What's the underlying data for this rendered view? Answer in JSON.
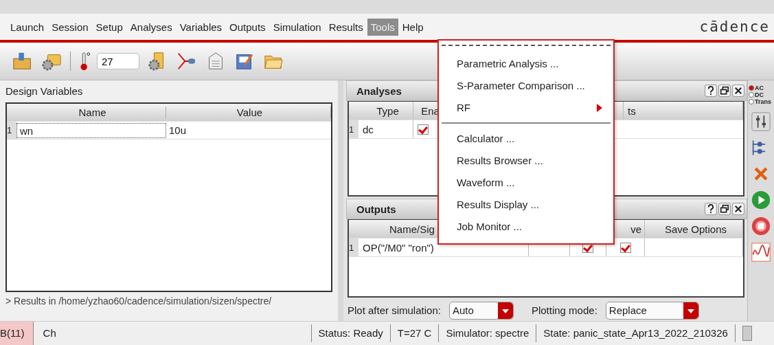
{
  "menu_bar": {
    "items": [
      {
        "label": "Launch",
        "selected": false
      },
      {
        "label": "Session",
        "selected": false
      },
      {
        "label": "Setup",
        "selected": false
      },
      {
        "label": "Analyses",
        "selected": false
      },
      {
        "label": "Variables",
        "selected": false
      },
      {
        "label": "Outputs",
        "selected": false
      },
      {
        "label": "Simulation",
        "selected": false
      },
      {
        "label": "Results",
        "selected": false
      },
      {
        "label": "Tools",
        "selected": true
      },
      {
        "label": "Help",
        "selected": false
      }
    ],
    "logo": "cādence"
  },
  "toolbar": {
    "temperature": "27"
  },
  "design_variables": {
    "title": "Design Variables",
    "columns": [
      "Name",
      "Value"
    ],
    "rows": [
      {
        "index": "1",
        "name": "wn",
        "value": "10u"
      }
    ]
  },
  "log_line": "> Results in /home/yzhao60/cadence/simulation/sizen/spectre/",
  "analyses": {
    "title": "Analyses",
    "columns": [
      "Type",
      "Ena",
      "ts"
    ],
    "rows": [
      {
        "index": "1",
        "type": "dc",
        "enabled": true
      }
    ]
  },
  "outputs": {
    "title": "Outputs",
    "columns": [
      "Name/Sig",
      "ve",
      "Save Options"
    ],
    "rows": [
      {
        "index": "1",
        "name": "OP(\"/M0\" \"ron\")",
        "plot": true,
        "save": true
      }
    ]
  },
  "plot_options": {
    "plot_after_label": "Plot after simulation:",
    "plot_after": "Auto",
    "plotting_mode_label": "Plotting mode:",
    "plotting_mode": "Replace"
  },
  "side_panel": {
    "analysis_types": [
      {
        "label": "AC",
        "selected": true
      },
      {
        "label": "DC",
        "selected": false
      },
      {
        "label": "Trans",
        "selected": false
      }
    ]
  },
  "tools_menu": {
    "items": [
      {
        "kind": "tearoff"
      },
      {
        "kind": "item",
        "label": "Parametric Analysis ..."
      },
      {
        "kind": "item",
        "label": "S-Parameter Comparison ..."
      },
      {
        "kind": "submenu",
        "label": "RF"
      },
      {
        "kind": "separator"
      },
      {
        "kind": "item",
        "label": "Calculator ..."
      },
      {
        "kind": "item",
        "label": "Results Browser ..."
      },
      {
        "kind": "item",
        "label": "Waveform ..."
      },
      {
        "kind": "item",
        "label": "Results Display ..."
      },
      {
        "kind": "item",
        "label": "Job Monitor ..."
      }
    ]
  },
  "status_bar": {
    "fields": [
      {
        "kind": "alert",
        "text": "B(11)"
      },
      {
        "kind": "wide",
        "text": "Ch"
      },
      {
        "kind": "plain",
        "text": "Status: Ready"
      },
      {
        "kind": "plain",
        "text": "T=27 C"
      },
      {
        "kind": "plain",
        "text": "Simulator: spectre"
      },
      {
        "kind": "plain",
        "text": "State: panic_state_Apr13_2022_210326"
      }
    ]
  }
}
